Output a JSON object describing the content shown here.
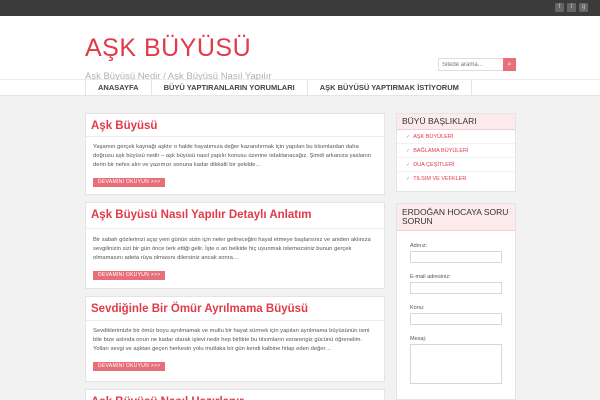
{
  "social": [
    {
      "icon": "facebook-icon",
      "glyph": "f"
    },
    {
      "icon": "twitter-icon",
      "glyph": "t"
    },
    {
      "icon": "googleplus-icon",
      "glyph": "g"
    }
  ],
  "site": {
    "title": "AŞK BÜYÜSÜ",
    "tagline": "Aşk Büyüsü Nedir / Aşk Büyüsü Nasıl Yapılır"
  },
  "search": {
    "placeholder": "Sitede arama...",
    "button_glyph": "⌕"
  },
  "nav": [
    "ANASAYFA",
    "BÜYÜ YAPTIRANLARIN YORUMLARI",
    "AŞK BÜYÜSÜ YAPTIRMAK İSTİYORUM"
  ],
  "posts": [
    {
      "title": "Aşk Büyüsü",
      "excerpt": "Yaşamın gerçek kaynağı aşktır o halde hayatımıza değer kazandırmak için yapılan bu tılsımlardan daha doğrusu aşk büyüsü nedir – aşk büyüsü nasıl yapılır konusu üzerine odaklanacağız. Şimdi arkanıza yaslanın derin bir nefes alın ve yazımızı sonuna kadar dikkatli bir şekilde…",
      "more": "DEVAMINI OKUYUN >>>"
    },
    {
      "title": "Aşk Büyüsü Nasıl Yapılır Detaylı Anlatım",
      "excerpt": "Bir sabah gözlerinizi açıp yeni günün sizin için neler getireceğini hayal etmeye başlarsınız ve aniden aklınıza sevgilinizin sizi bir gün önce terk ettiği gelir. İşte o an belkide hiç uyunmak istemezsiniz bunun gerçek olmamasını adeta rüya olmasını dilersiniz ancak sonra…",
      "more": "DEVAMINI OKUYUN >>>"
    },
    {
      "title": "Sevdiğinle Bir Ömür Ayrılmama Büyüsü",
      "excerpt": "Sevdiklerimizle bir ömür boyu ayrılmamak ve mutlu bir hayat sürmek için yapılan ayrılmama büyüsünün ismi bile bize aslında onun ne kadar olarak işlevi nedir hep birlikte bu tılsımların esrarengiz gücünü öğrenelim. Yolları sevgi ve aşktan geçen herkesin yolu mutlaka bir gün kendi kalbine hitap eden değer…",
      "more": "DEVAMINI OKUYUN >>>"
    },
    {
      "title": "Aşk Büyüsü Nasıl Hazırlanır",
      "excerpt": "",
      "more": ""
    }
  ],
  "sidebar": {
    "categories_title": "BÜYÜ BAŞLIKLARI",
    "categories": [
      "AŞK BÜYÜLERİ",
      "BAĞLAMA BÜYÜLERİ",
      "DUA ÇEŞİTLERİ",
      "TILSIM VE VEFKLER"
    ],
    "contact_title": "ERDOĞAN HOCAYA SORU SORUN",
    "fields": [
      "Adınız:",
      "E-mail adresiniz:",
      "Konu:",
      "Mesaj:"
    ]
  },
  "colors": {
    "accent": "#e23a48",
    "button": "#e86f7a",
    "topbar": "#3b3b3b"
  }
}
